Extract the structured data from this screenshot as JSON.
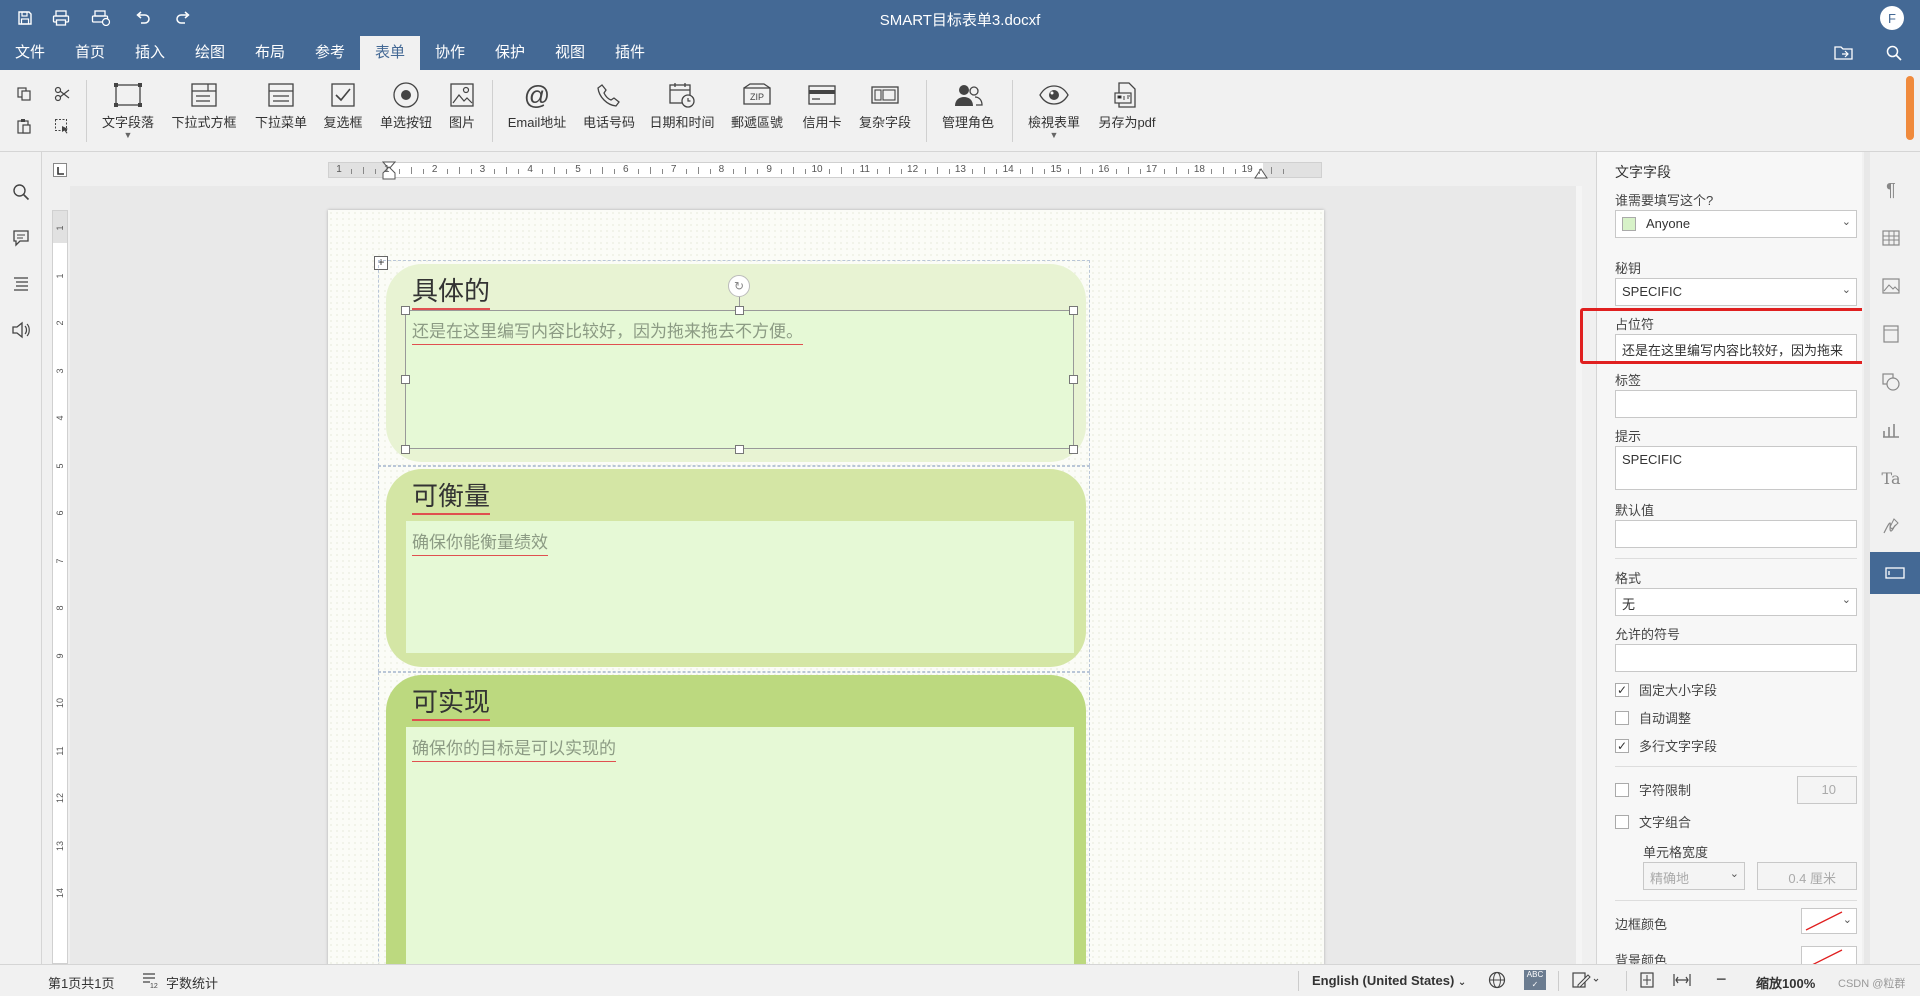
{
  "window": {
    "title": "SMART目标表单3.docxf",
    "user_initial": "F"
  },
  "quick_access": [
    {
      "name": "save-icon"
    },
    {
      "name": "print-icon"
    },
    {
      "name": "quick-print-icon"
    },
    {
      "name": "undo-icon"
    },
    {
      "name": "redo-icon"
    }
  ],
  "menu": {
    "tabs": [
      "文件",
      "首页",
      "插入",
      "绘图",
      "布局",
      "参考",
      "表单",
      "协作",
      "保护",
      "视图",
      "插件"
    ],
    "active": "表单"
  },
  "toolbar": {
    "buttons": [
      {
        "label": "文字段落",
        "icon": "text-field-icon",
        "has_dropdown": true
      },
      {
        "label": "下拉式方框",
        "icon": "combo-box-icon"
      },
      {
        "label": "下拉菜单",
        "icon": "dropdown-list-icon"
      },
      {
        "label": "复选框",
        "icon": "checkbox-icon"
      },
      {
        "label": "单选按钮",
        "icon": "radio-button-icon"
      },
      {
        "label": "图片",
        "icon": "image-icon"
      },
      {
        "label": "Email地址",
        "icon": "at-icon"
      },
      {
        "label": "电话号码",
        "icon": "phone-icon"
      },
      {
        "label": "日期和时间",
        "icon": "calendar-icon"
      },
      {
        "label": "郵遞區號",
        "icon": "zip-icon"
      },
      {
        "label": "信用卡",
        "icon": "credit-card-icon"
      },
      {
        "label": "复杂字段",
        "icon": "complex-field-icon"
      },
      {
        "label": "管理角色",
        "icon": "roles-icon"
      },
      {
        "label": "檢視表單",
        "icon": "eye-icon",
        "has_dropdown": true
      },
      {
        "label": "另存为pdf",
        "icon": "save-pdf-icon"
      }
    ]
  },
  "ruler": {
    "h_numbers": [
      "1",
      "1",
      "2",
      "3",
      "4",
      "5",
      "6",
      "7",
      "8",
      "9",
      "10",
      "11",
      "12",
      "13",
      "14",
      "15",
      "16",
      "17",
      "18",
      "19"
    ],
    "v_numbers": [
      "1",
      "1",
      "2",
      "3",
      "4",
      "5",
      "6",
      "7",
      "8",
      "9",
      "10",
      "11",
      "12",
      "13",
      "14"
    ]
  },
  "document": {
    "cards": [
      {
        "title": "具体的",
        "placeholder": "还是在这里编写内容比较好，因为拖来拖去不方便。",
        "bg": "#e8f3d3"
      },
      {
        "title": "可衡量",
        "placeholder": "确保你能衡量绩效",
        "bg": "#d4e6a5"
      },
      {
        "title": "可实现",
        "placeholder": "确保你的目标是可以实现的",
        "bg": "#bcd97f"
      }
    ]
  },
  "panel": {
    "heading": "文字字段",
    "who_label": "谁需要填写这个?",
    "who_value": "Anyone",
    "who_color": "#d7f2c8",
    "key_label": "秘钥",
    "key_value": "SPECIFIC",
    "placeholder_label": "占位符",
    "placeholder_value": "还是在这里编写内容比较好，因为拖来",
    "tag_label": "标签",
    "tag_value": "",
    "tip_label": "提示",
    "tip_value": "SPECIFIC",
    "default_label": "默认值",
    "default_value": "",
    "format_label": "格式",
    "format_value": "无",
    "allowed_label": "允许的符号",
    "allowed_value": "",
    "fixed_size": {
      "label": "固定大小字段",
      "checked": true
    },
    "autofit": {
      "label": "自动调整",
      "checked": false
    },
    "multiline": {
      "label": "多行文字字段",
      "checked": true
    },
    "char_limit": {
      "label": "字符限制",
      "checked": false,
      "value": "10"
    },
    "comb": {
      "label": "文字组合",
      "checked": false
    },
    "cell_width_label": "单元格宽度",
    "cell_width_mode": "精确地",
    "cell_width_value": "0.4 厘米",
    "border_color_label": "边框颜色",
    "bg_color_label": "背景颜色"
  },
  "status": {
    "pages": "第1页共1页",
    "word_count": "字数统计",
    "language": "English (United States)",
    "zoom": "缩放100%",
    "watermark": "CSDN @粒群"
  },
  "colors": {
    "titlebar": "#446995",
    "highlight": "#e02020",
    "spell_underline": "#e05050"
  }
}
